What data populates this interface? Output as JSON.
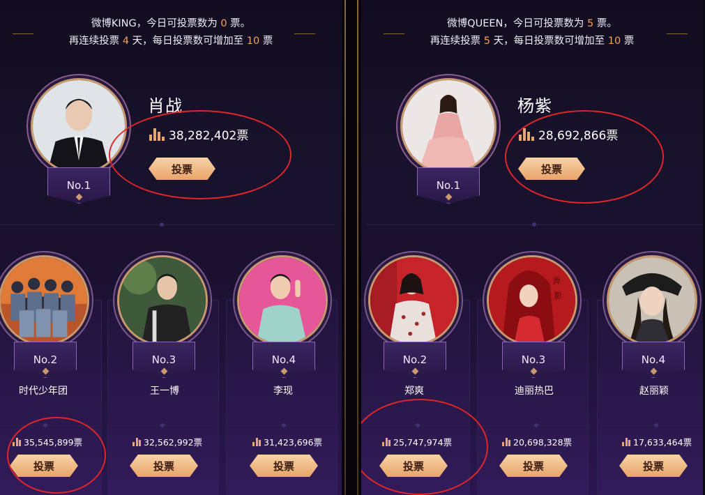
{
  "king": {
    "info_line1_pre": "微博KING，今日可投票数为",
    "info_line1_num": "0",
    "info_line1_post": "票。",
    "info_line2_pre": "再连续投票",
    "info_line2_days": "4",
    "info_line2_mid": "天，每日投票数可增加至",
    "info_line2_num": "10",
    "info_line2_post": "票",
    "top": {
      "name": "肖战",
      "votes": "38,282,402票",
      "rank": "No.1",
      "button": "投票"
    },
    "others": [
      {
        "name": "时代少年团",
        "votes": "35,545,899票",
        "rank": "No.2",
        "button": "投票"
      },
      {
        "name": "王一博",
        "votes": "32,562,992票",
        "rank": "No.3",
        "button": "投票"
      },
      {
        "name": "李现",
        "votes": "31,423,696票",
        "rank": "No.4",
        "button": "投票"
      }
    ]
  },
  "queen": {
    "info_line1_pre": "微博QUEEN，今日可投票数为",
    "info_line1_num": "5",
    "info_line1_post": "票。",
    "info_line2_pre": "再连续投票",
    "info_line2_days": "5",
    "info_line2_mid": "天，每日投票数可增加至",
    "info_line2_num": "10",
    "info_line2_post": "票",
    "top": {
      "name": "杨紫",
      "votes": "28,692,866票",
      "rank": "No.1",
      "button": "投票"
    },
    "others": [
      {
        "name": "郑爽",
        "votes": "25,747,974票",
        "rank": "No.2",
        "button": "投票"
      },
      {
        "name": "迪丽热巴",
        "votes": "20,698,328票",
        "rank": "No.3",
        "button": "投票"
      },
      {
        "name": "赵丽颖",
        "votes": "17,633,464票",
        "rank": "No.4",
        "button": "投票"
      }
    ]
  },
  "colors": {
    "accent": "#f5a25b",
    "button": "#e9a46a",
    "annotation": "#e0262b",
    "frame": "#c89a6e"
  },
  "icons": [
    "vote-bar-icon",
    "diamond-icon"
  ]
}
